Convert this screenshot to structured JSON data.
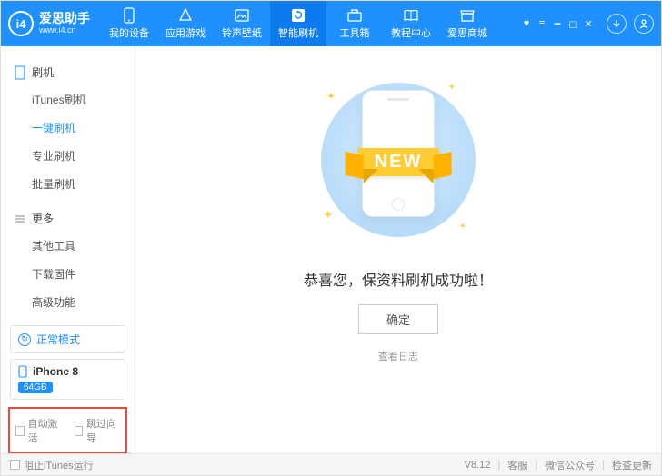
{
  "header": {
    "logo_badge": "i4",
    "logo_title": "爱思助手",
    "logo_url": "www.i4.cn",
    "tabs": [
      {
        "label": "我的设备"
      },
      {
        "label": "应用游戏"
      },
      {
        "label": "铃声壁纸"
      },
      {
        "label": "智能刷机"
      },
      {
        "label": "工具箱"
      },
      {
        "label": "教程中心"
      },
      {
        "label": "爱思商城"
      }
    ]
  },
  "sidebar": {
    "group1_title": "刷机",
    "group1_items": [
      "iTunes刷机",
      "一键刷机",
      "专业刷机",
      "批量刷机"
    ],
    "group2_title": "更多",
    "group2_items": [
      "其他工具",
      "下载固件",
      "高级功能"
    ],
    "mode_label": "正常模式",
    "device_name": "iPhone 8",
    "device_storage": "64GB",
    "opt_auto_activate": "自动激活",
    "opt_skip_guide": "跳过向导"
  },
  "main": {
    "ribbon_text": "NEW",
    "success_text": "恭喜您，保资料刷机成功啦！",
    "ok_label": "确定",
    "log_label": "查看日志"
  },
  "footer": {
    "block_itunes": "阻止iTunes运行",
    "version": "V8.12",
    "support": "客服",
    "wechat": "微信公众号",
    "check_update": "检查更新"
  }
}
